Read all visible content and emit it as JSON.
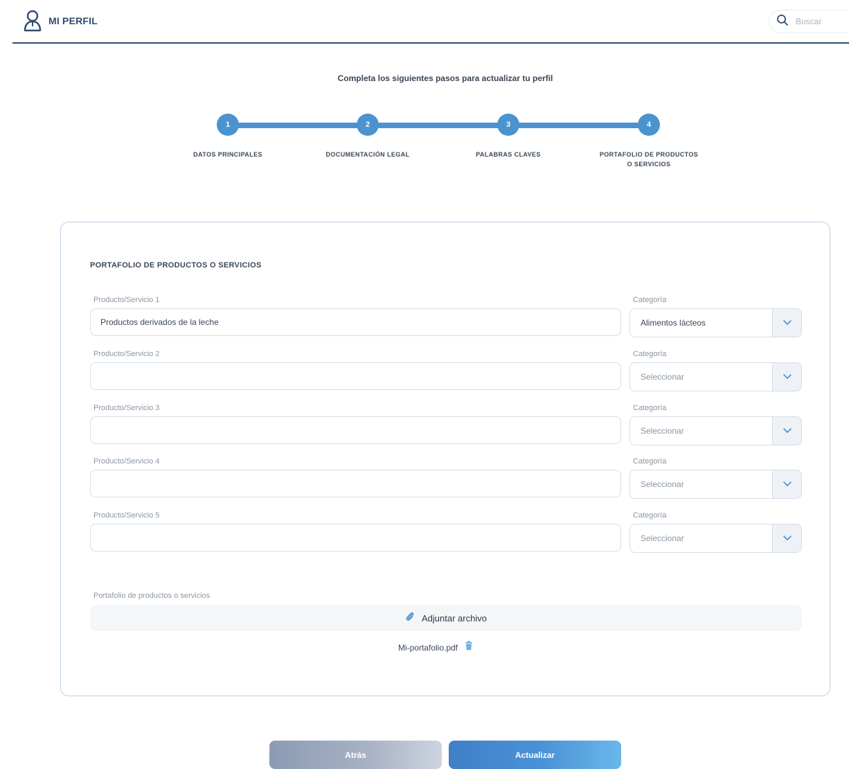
{
  "header": {
    "title": "MI PERFIL",
    "search_placeholder": "Buscar"
  },
  "instruction": "Completa los siguientes pasos para actualizar tu perfil",
  "stepper": {
    "steps": [
      {
        "number": "1",
        "label": "DATOS PRINCIPALES"
      },
      {
        "number": "2",
        "label": "DOCUMENTACIÓN LEGAL"
      },
      {
        "number": "3",
        "label": "PALABRAS CLAVES"
      },
      {
        "number": "4",
        "label_line1": "PORTAFOLIO DE PRODUCTOS",
        "label_line2": "O SERVICIOS"
      }
    ],
    "active_step": 4
  },
  "form": {
    "section_title": "PORTAFOLIO DE PRODUCTOS O SERVICIOS",
    "rows": [
      {
        "product_label": "Producto/Servicio 1",
        "product_value": "Productos derivados de la leche",
        "category_label": "Categoría",
        "category_value": "Alimentos lácteos"
      },
      {
        "product_label": "Producto/Servicio 2",
        "product_value": "",
        "category_label": "Categoría",
        "category_value": "Seleccionar"
      },
      {
        "product_label": "Producto/Servicio 3",
        "product_value": "",
        "category_label": "Categoría",
        "category_value": "Seleccionar"
      },
      {
        "product_label": "Producto/Servicio 4",
        "product_value": "",
        "category_label": "Categoría",
        "category_value": "Seleccionar"
      },
      {
        "product_label": "Producto/Servicio 5",
        "product_value": "",
        "category_label": "Categoría",
        "category_value": "Seleccionar"
      }
    ],
    "attachment_label": "Portafolio de productos o servicios",
    "attach_button_label": "Adjuntar archivo",
    "file_name": "Mi-portafolio.pdf"
  },
  "actions": {
    "back_label": "Atrás",
    "update_label": "Actualizar"
  },
  "colors": {
    "primary": "#4a93cf",
    "header_text": "#2f4c6e"
  }
}
